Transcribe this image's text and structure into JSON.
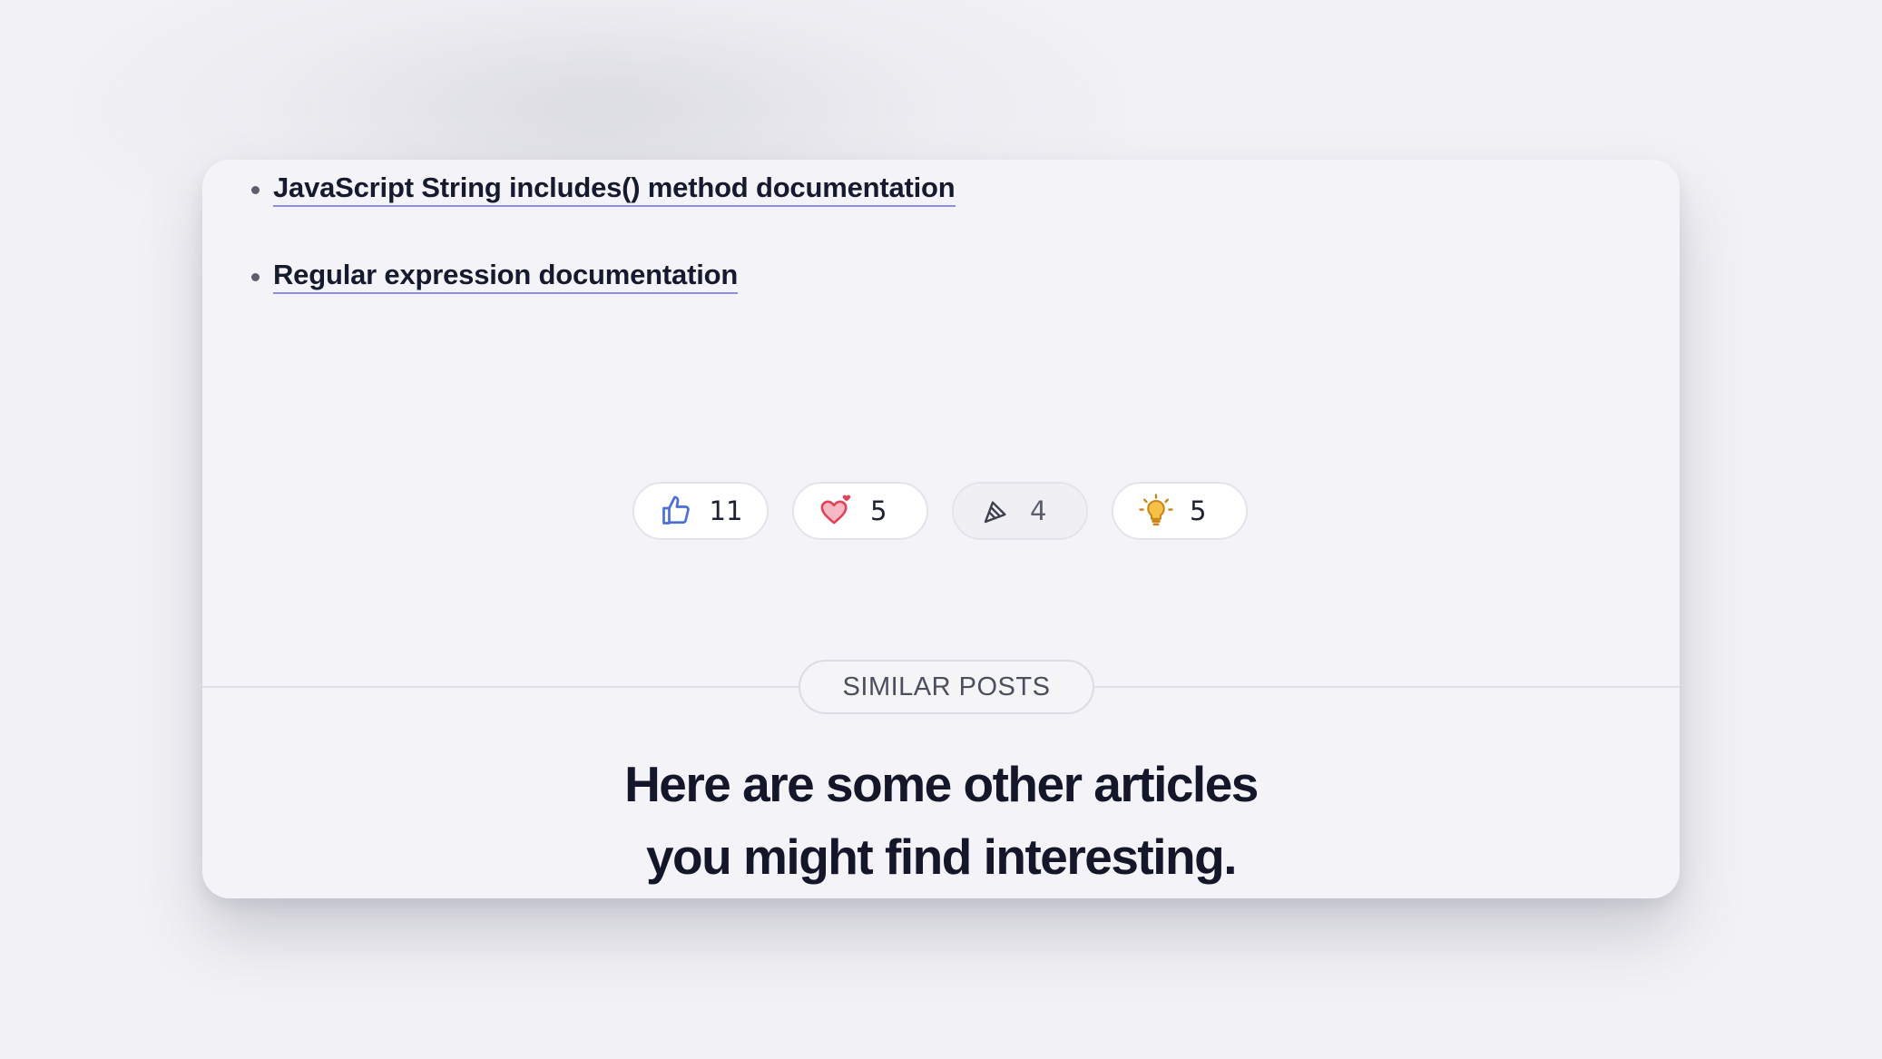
{
  "links": [
    {
      "label": "JavaScript String includes() method documentation"
    },
    {
      "label": "Regular expression documentation"
    }
  ],
  "reactions": [
    {
      "icon": "thumbs-up-icon",
      "count": "11"
    },
    {
      "icon": "heart-icon",
      "count": "5"
    },
    {
      "icon": "party-popper-icon",
      "count": "4"
    },
    {
      "icon": "lightbulb-icon",
      "count": "5"
    }
  ],
  "similar": {
    "badge": "SIMILAR POSTS",
    "headline_line1": "Here are some other articles",
    "headline_line2": "you might find interesting."
  },
  "colors": {
    "page_background": "#f2f2f6",
    "card_background": "#f4f4f8",
    "link_underline": "#8b8fd8",
    "thumbs_up": "#4a6fd6",
    "heart": "#e0445a",
    "lightbulb": "#f2b53a"
  }
}
